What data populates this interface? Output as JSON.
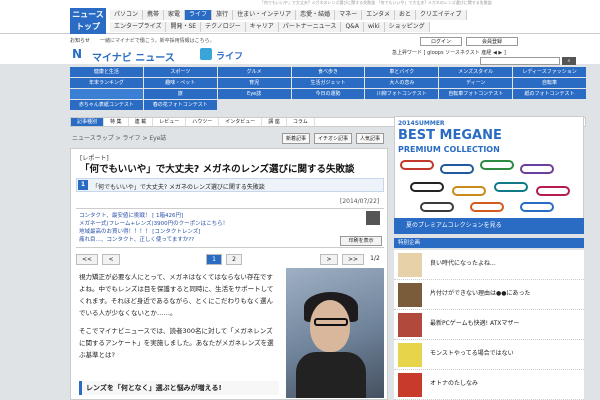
{
  "nav": {
    "news_top": "ニュース トップ",
    "row1": [
      "パソコン",
      "携帯",
      "家電",
      "ライフ",
      "旅行",
      "住まい・インテリア",
      "恋愛・結婚",
      "マネー",
      "エンタメ",
      "おと",
      "クリエイティブ"
    ],
    "row2": [
      "エンタープライズ",
      "開発・SE",
      "テクノロジー",
      "キャリア",
      "パートナーニュース",
      "Q&A",
      "wiki",
      "ショッピング"
    ],
    "active": "ライフ",
    "ticker": "「何でもいいや」で大丈夫? メガネのレンズ選びに関する失敗談 「何でもいいや」で大丈夫? メガネのレンズ選びに関する失敗談"
  },
  "header": {
    "oshirase_label": "お知らせ",
    "oshirase_text": "一緒にマイナビで働こう。新卒採用情報はこちら。",
    "logo_mark": "N",
    "logo_text": "マイナビ ニュース",
    "life_text": "ライフ",
    "login": "ログイン",
    "register": "会員登録",
    "hotword": "急上昇ワード [ gloops ソースネクスト 産経 ◀ ▶ ]"
  },
  "categories": [
    "健康と生活",
    "スポーツ",
    "グルメ",
    "食べ歩き",
    "車とバイク",
    "メンズスタイル",
    "レディースファッション",
    "年末ランキング",
    "趣味・ペット",
    "育児",
    "生活ガジェット",
    "大人の恋み",
    "ディーン",
    "自転車",
    "",
    "旅",
    "Eye誌",
    "今日の運勢",
    "川柳フォトコンテスト",
    "自転車フォトコンテスト",
    "紙のフォトコンテスト",
    "赤ちゃん表紙コンテスト",
    "春の花フォトコンテスト"
  ],
  "subnav": [
    "記事種別",
    "特 集",
    "連 載",
    "レビュー",
    "ハウツー",
    "インタビュー",
    "講 座",
    "コラム"
  ],
  "breadcrumb": "ニュースラップ > ライフ > Eye誌",
  "tags": [
    "新着記事",
    "イチオシ記事",
    "人気記事"
  ],
  "article": {
    "label": "[レポート]",
    "title": "「何でもいいや」で大丈夫? メガネのレンズ選びに関する失敗談",
    "section_num": "1",
    "section_title": "「何でもいいや」で大丈夫? メガネのレンズ選びに関する失敗談",
    "date": "[2014/07/22]",
    "ads": [
      "コンタクト、最安値に挑戦！ [ 1箱426円]",
      "メガネ一式(フレーム+レンズ)3900円のクーポンはこちら！",
      "地域最高のお買い得！！！！ [コンタクトレンズ]",
      "痛れ目…、コンタクト、正しく使ってますか??"
    ],
    "print": "印刷を表示",
    "pager": {
      "prev2": "<<",
      "prev": "<",
      "current": "1",
      "next2": "2",
      "next": ">",
      "last": ">>",
      "count": "1/2"
    },
    "body": [
      "視力矯正が必要な人にとって、メガネはなくてはならない存在ですよね。中でもレンズは目を保護すると同時に、生活をサポートしてくれます。それほど身近であるながら、とくにこだわりもなく選んでいる人が少なくないとか……。",
      "そこでマイナビニュースでは、読者300名に対して「メガネレンズに関するアンケート」を実施しました。あなたがメガネレンズを選ぶ基準とは?"
    ],
    "sub_heading": "レンズを「何となく」選ぶと悩みが増える!"
  },
  "banner": {
    "year": "2014SUMMER",
    "title": "BEST MEGANE",
    "subtitle": "PREMIUM COLLECTION",
    "bottom": "夏のプレミアムコレクションを見る"
  },
  "side": {
    "header": "特別企画",
    "items": [
      "良い時代になったよね...",
      "片付けができない理由は●●にあった",
      "最新PCゲームも快適! ATXマザー",
      "モンストやってる場合ではない",
      "オトナのたしなみ"
    ],
    "thumb_colors": [
      "#e6d1a8",
      "#7a5c3a",
      "#b14a3c",
      "#e8d44a",
      "#c83b2b"
    ]
  },
  "colors": {
    "accent": "#2a6cc4"
  }
}
